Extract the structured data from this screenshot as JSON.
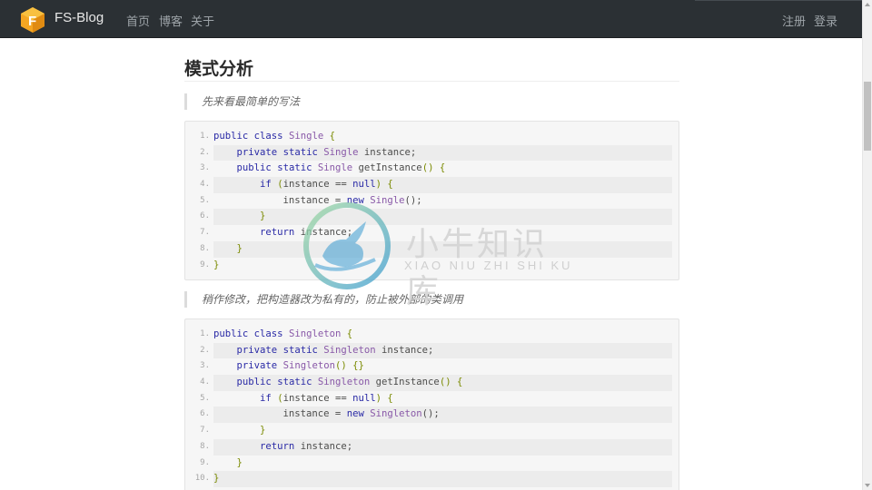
{
  "navbar": {
    "brand": "FS-Blog",
    "logo_letter": "F",
    "links": {
      "home": "首页",
      "blog": "博客",
      "about": "关于"
    },
    "auth": {
      "register": "注册",
      "login": "登录"
    }
  },
  "article": {
    "section_title": "模式分析",
    "quote_1": "先来看最简单的写法",
    "quote_2": "稍作修改，把构造器改为私有的，防止被外部的类调用"
  },
  "code_block_1": {
    "lines": [
      {
        "n": "1.",
        "t": "public class Single {"
      },
      {
        "n": "2.",
        "t": "    private static Single instance;"
      },
      {
        "n": "3.",
        "t": "    public static Single getInstance() {"
      },
      {
        "n": "4.",
        "t": "        if (instance == null) {"
      },
      {
        "n": "5.",
        "t": "            instance = new Single();"
      },
      {
        "n": "6.",
        "t": "        }"
      },
      {
        "n": "7.",
        "t": "        return instance;"
      },
      {
        "n": "8.",
        "t": "    }"
      },
      {
        "n": "9.",
        "t": "}"
      }
    ]
  },
  "code_block_2": {
    "lines": [
      {
        "n": "1.",
        "t": "public class Singleton {"
      },
      {
        "n": "2.",
        "t": "    private static Singleton instance;"
      },
      {
        "n": "3.",
        "t": "    private Singleton() {}"
      },
      {
        "n": "4.",
        "t": "    public static Singleton getInstance() {"
      },
      {
        "n": "5.",
        "t": "        if (instance == null) {"
      },
      {
        "n": "6.",
        "t": "            instance = new Singleton();"
      },
      {
        "n": "7.",
        "t": "        }"
      },
      {
        "n": "8.",
        "t": "        return instance;"
      },
      {
        "n": "9.",
        "t": "    }"
      },
      {
        "n": "10.",
        "t": "}"
      }
    ]
  },
  "watermark": {
    "text": "小牛知识库",
    "subtext": "XIAO NIU ZHI SHI KU"
  },
  "colors": {
    "navbar_bg": "#2b3034",
    "logo_orange": "#f5a623",
    "keyword": "#2a2aa6",
    "type": "#8959a8"
  }
}
